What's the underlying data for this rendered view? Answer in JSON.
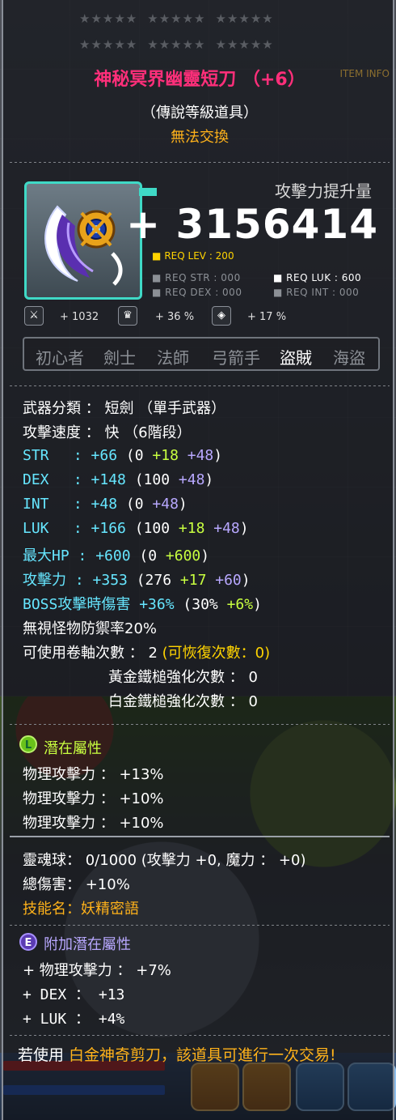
{
  "header": {
    "stars_row1": [
      "★★★★★",
      "★★★★★",
      "★★★★★"
    ],
    "stars_row2": [
      "★★★★★",
      "★★★★★",
      "★★★★★"
    ],
    "item_name": "神秘冥界幽靈短刀 （+6）",
    "info_tag": "ITEM INFO",
    "grade": "（傳說等級道具）",
    "tradeable": "無法交換"
  },
  "attack": {
    "label": "攻擊力提升量",
    "value": "+ 3156414"
  },
  "requirements": {
    "lev": "REQ LEV : 200",
    "str": "REQ STR : 000",
    "dex": "REQ DEX : 000",
    "luk": "REQ LUK : 600",
    "int": "REQ INT : 000"
  },
  "small_stats": {
    "boss_icon": "boss-damage-icon",
    "boss_value": "+ 1032",
    "ied_icon": "armor-ignore-icon",
    "ied_value": "+ 36 %",
    "dmg_icon": "shield-icon",
    "dmg_value": "+ 17 %"
  },
  "jobs": [
    "初心者",
    "劍士",
    "法師",
    "弓箭手",
    "盜賊",
    "海盜"
  ],
  "active_job_index": 4,
  "stats": {
    "category_label": "武器分類 ：",
    "category_value": " 短劍 （單手武器）",
    "speed_label": "攻擊速度 ：",
    "speed_value": " 快 （6階段）",
    "str": {
      "name": "STR",
      "colon": " : ",
      "total": "+66",
      "base": "(0 ",
      "bonus": "+18",
      "star": " +48",
      "close": ")"
    },
    "dex": {
      "name": "DEX",
      "colon": " : ",
      "total": "+148",
      "base": "(100 ",
      "star": "+48",
      "close": ")"
    },
    "int": {
      "name": "INT",
      "colon": " : ",
      "total": "+48",
      "base": "(0 ",
      "star": "+48",
      "close": ")"
    },
    "luk": {
      "name": "LUK",
      "colon": " : ",
      "total": "+166",
      "base": "(100 ",
      "bonus": "+18",
      "star": " +48",
      "close": ")"
    },
    "hp": {
      "name": "最大HP",
      "colon": " : ",
      "total": "+600",
      "base": "(0 ",
      "star": "+600",
      "close": ")"
    },
    "atk": {
      "name": "攻擊力",
      "colon": " : ",
      "total": "+353",
      "base": "(276 ",
      "bonus": "+17",
      "star": " +60",
      "close": ")"
    },
    "boss": {
      "name": "BOSS攻擊時傷害",
      "total": " +36%",
      "base": "(30% ",
      "bonus": "+6%",
      "close": ")"
    },
    "ied": "無視怪物防禦率20%",
    "scroll_label": "可使用卷軸次數 ： 2 ",
    "scroll_restore": "(可恢復次數：0)",
    "gold_hammer": "黃金鐵槌強化次數 ： 0",
    "white_hammer": "白金鐵槌強化次數 ： 0"
  },
  "potential": {
    "badge": "L",
    "title": "潛在屬性",
    "lines": [
      "物理攻擊力 ： +13%",
      "物理攻擊力 ： +10%",
      "物理攻擊力 ： +10%"
    ]
  },
  "soul": {
    "line1": "靈魂球： 0/1000 (攻擊力 +0, 魔力 ： +0)",
    "line2": "總傷害： +10%",
    "line3": "技能名：妖精密語"
  },
  "additional": {
    "badge": "E",
    "title": "附加潛在屬性",
    "lines": [
      "+ 物理攻擊力 ： +7%",
      "+ DEX ： +13",
      "+ LUK ： +4%"
    ]
  },
  "footer": {
    "prefix": "若使用 ",
    "highlight": "白金神奇剪刀，該道具可進行一次交易!"
  },
  "colors": {
    "name": "#ff2f7a",
    "untradeable": "#ffb21a",
    "cyan_stat": "#66e6ff",
    "bonus_green": "#c8ff40",
    "star_purple": "#b8a8ff",
    "legend_badge": "#69c21a",
    "additional_badge": "#5b3bb3"
  }
}
